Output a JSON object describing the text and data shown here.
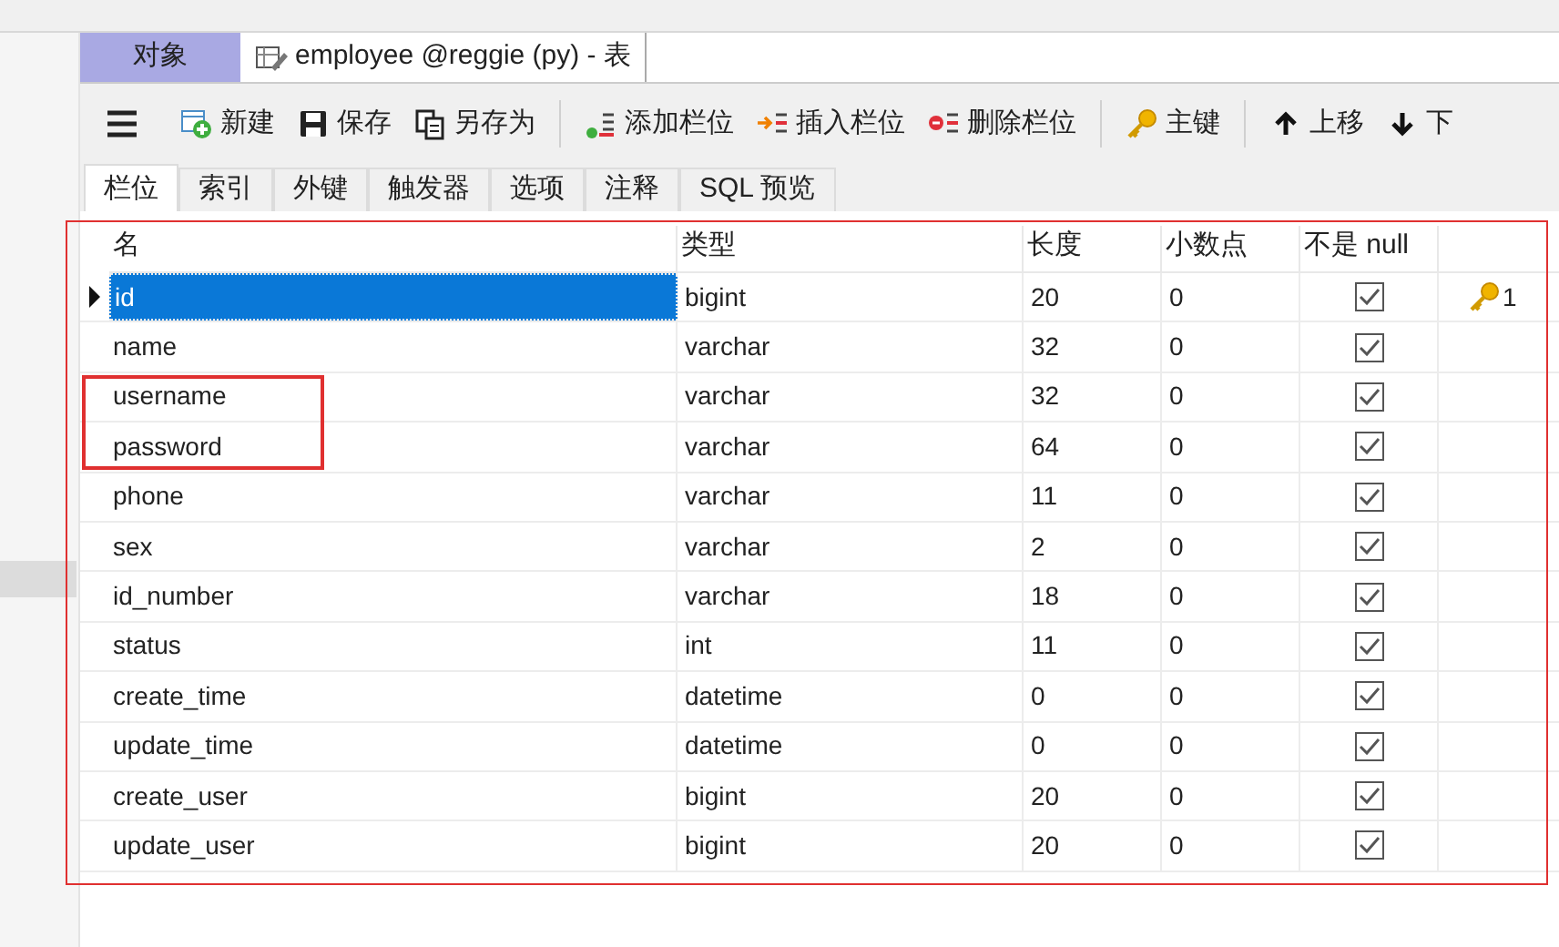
{
  "doc_tabs": [
    {
      "label": "对象",
      "selected": false
    },
    {
      "label": "employee @reggie (py) - 表",
      "selected": true
    }
  ],
  "toolbar": [
    {
      "kind": "menu"
    },
    {
      "kind": "button",
      "label": "新建"
    },
    {
      "kind": "button",
      "label": "保存"
    },
    {
      "kind": "button",
      "label": "另存为"
    },
    {
      "kind": "separator"
    },
    {
      "kind": "button",
      "label": "添加栏位"
    },
    {
      "kind": "button",
      "label": "插入栏位"
    },
    {
      "kind": "button",
      "label": "删除栏位"
    },
    {
      "kind": "separator"
    },
    {
      "kind": "button",
      "label": "主键"
    },
    {
      "kind": "separator"
    },
    {
      "kind": "button",
      "label": "上移"
    },
    {
      "kind": "button",
      "label": "下"
    }
  ],
  "sub_tabs": [
    {
      "label": "栏位",
      "selected": true
    },
    {
      "label": "索引",
      "selected": false
    },
    {
      "label": "外键",
      "selected": false
    },
    {
      "label": "触发器",
      "selected": false
    },
    {
      "label": "选项",
      "selected": false
    },
    {
      "label": "注释",
      "selected": false
    },
    {
      "label": "SQL 预览",
      "selected": false
    }
  ],
  "table": {
    "columns": [
      "名",
      "类型",
      "长度",
      "小数点",
      "不是 null"
    ],
    "rows": [
      {
        "name": "id",
        "type": "bigint",
        "length": "20",
        "decimals": "0",
        "not_null": true,
        "selected": true,
        "key": "1"
      },
      {
        "name": "name",
        "type": "varchar",
        "length": "32",
        "decimals": "0",
        "not_null": true,
        "selected": false
      },
      {
        "name": "username",
        "type": "varchar",
        "length": "32",
        "decimals": "0",
        "not_null": true,
        "selected": false,
        "annotated": true
      },
      {
        "name": "password",
        "type": "varchar",
        "length": "64",
        "decimals": "0",
        "not_null": true,
        "selected": false,
        "annotated": true
      },
      {
        "name": "phone",
        "type": "varchar",
        "length": "11",
        "decimals": "0",
        "not_null": true,
        "selected": false
      },
      {
        "name": "sex",
        "type": "varchar",
        "length": "2",
        "decimals": "0",
        "not_null": true,
        "selected": false
      },
      {
        "name": "id_number",
        "type": "varchar",
        "length": "18",
        "decimals": "0",
        "not_null": true,
        "selected": false
      },
      {
        "name": "status",
        "type": "int",
        "length": "11",
        "decimals": "0",
        "not_null": true,
        "selected": false
      },
      {
        "name": "create_time",
        "type": "datetime",
        "length": "0",
        "decimals": "0",
        "not_null": true,
        "selected": false
      },
      {
        "name": "update_time",
        "type": "datetime",
        "length": "0",
        "decimals": "0",
        "not_null": true,
        "selected": false
      },
      {
        "name": "create_user",
        "type": "bigint",
        "length": "20",
        "decimals": "0",
        "not_null": true,
        "selected": false
      },
      {
        "name": "update_user",
        "type": "bigint",
        "length": "20",
        "decimals": "0",
        "not_null": true,
        "selected": false
      }
    ]
  }
}
